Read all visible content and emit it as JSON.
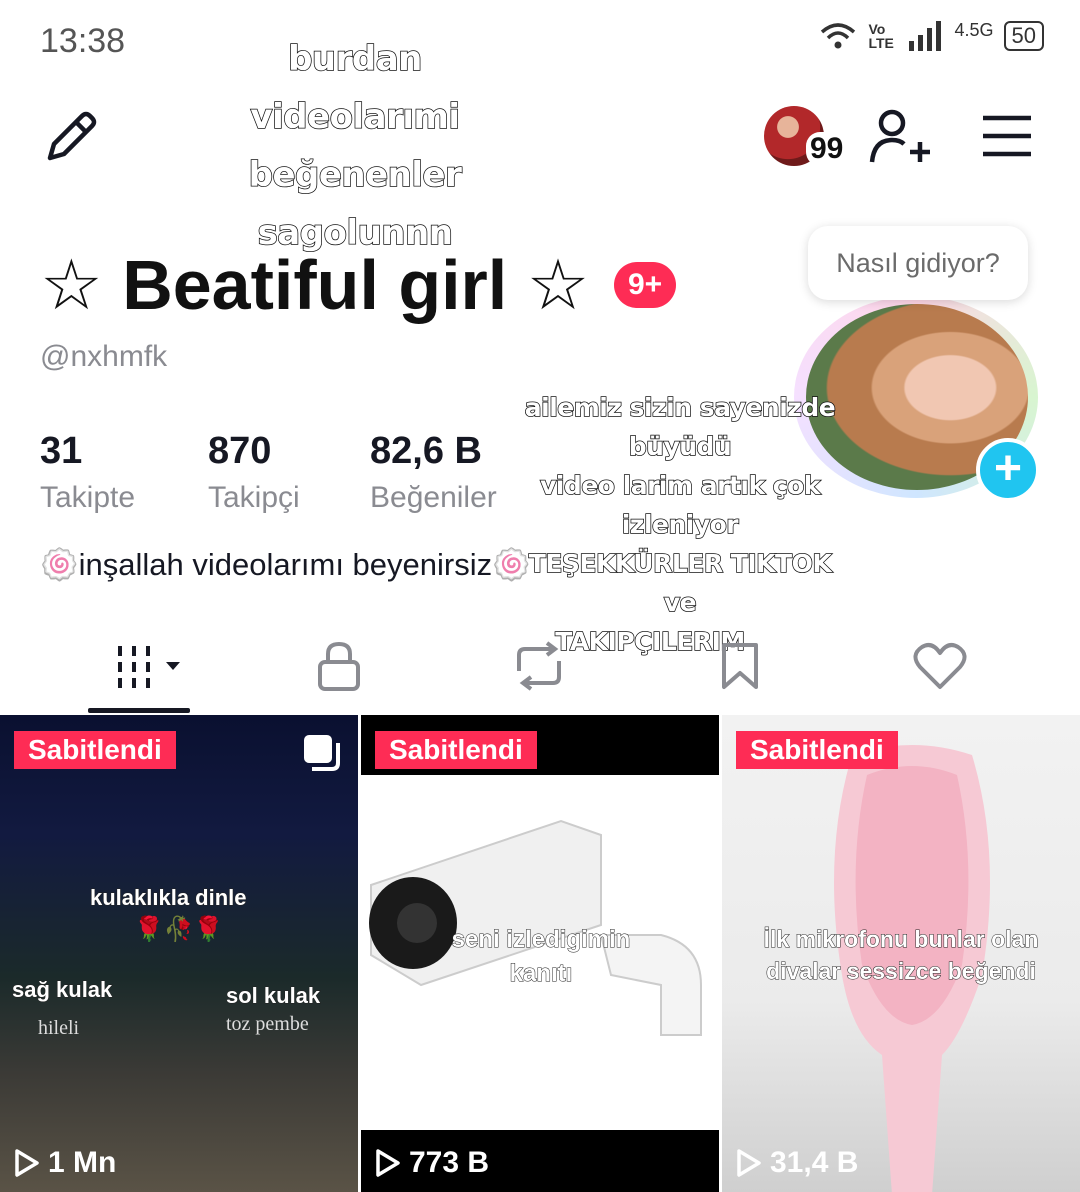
{
  "status_bar": {
    "time": "13:38",
    "network": "4.5G",
    "volte": "Vo LTE",
    "battery": "50"
  },
  "overlay_captions": {
    "top_lines": [
      "burdan",
      "videolarımi beğenenler",
      "sagolunnn"
    ],
    "middle_lines": [
      "ailemiz sizin sayenizde büyüdü",
      "video larim artık çok izleniyor",
      "TEŞEKKÜRLER TIKTOK",
      "ve",
      "TAKIPÇILERIM"
    ]
  },
  "header": {
    "edit_icon": "pencil-icon",
    "friends_count": "99",
    "add_user_icon": "add-user-icon",
    "menu_icon": "hamburger-menu-icon"
  },
  "profile": {
    "name": "☆ Beatiful girl ☆",
    "badge": "9+",
    "username": "@nxhmfk",
    "bubble_text": "Nasıl gidiyor?",
    "bio": "🍥inşallah videolarımı beyenirsiz🍥"
  },
  "stats": [
    {
      "value": "31",
      "label": "Takipte"
    },
    {
      "value": "870",
      "label": "Takipçi"
    },
    {
      "value": "82,6 B",
      "label": "Beğeniler"
    }
  ],
  "tabs": [
    {
      "name": "videos",
      "icon": "grid-icon",
      "active": true
    },
    {
      "name": "private",
      "icon": "lock-icon",
      "active": false
    },
    {
      "name": "reposts",
      "icon": "repost-icon",
      "active": false
    },
    {
      "name": "favorites",
      "icon": "bookmark-icon",
      "active": false
    },
    {
      "name": "liked",
      "icon": "heart-icon",
      "active": false
    }
  ],
  "videos": [
    {
      "pinned_label": "Sabitlendi",
      "views": "1 Mn",
      "caption": "kulaklıkla dinle",
      "emoji": "🌹🥀🌹",
      "left_label": "sağ kulak",
      "left_sub": "hileli",
      "right_label": "sol kulak",
      "right_sub": "toz pembe"
    },
    {
      "pinned_label": "Sabitlendi",
      "views": "773 B",
      "caption_lines": [
        "seni izledigimin",
        "kanıtı"
      ]
    },
    {
      "pinned_label": "Sabitlendi",
      "views": "31,4 B",
      "caption_lines": [
        "İlk mikrofonu bunlar olan",
        "divalar sessizce beğendi"
      ]
    }
  ]
}
